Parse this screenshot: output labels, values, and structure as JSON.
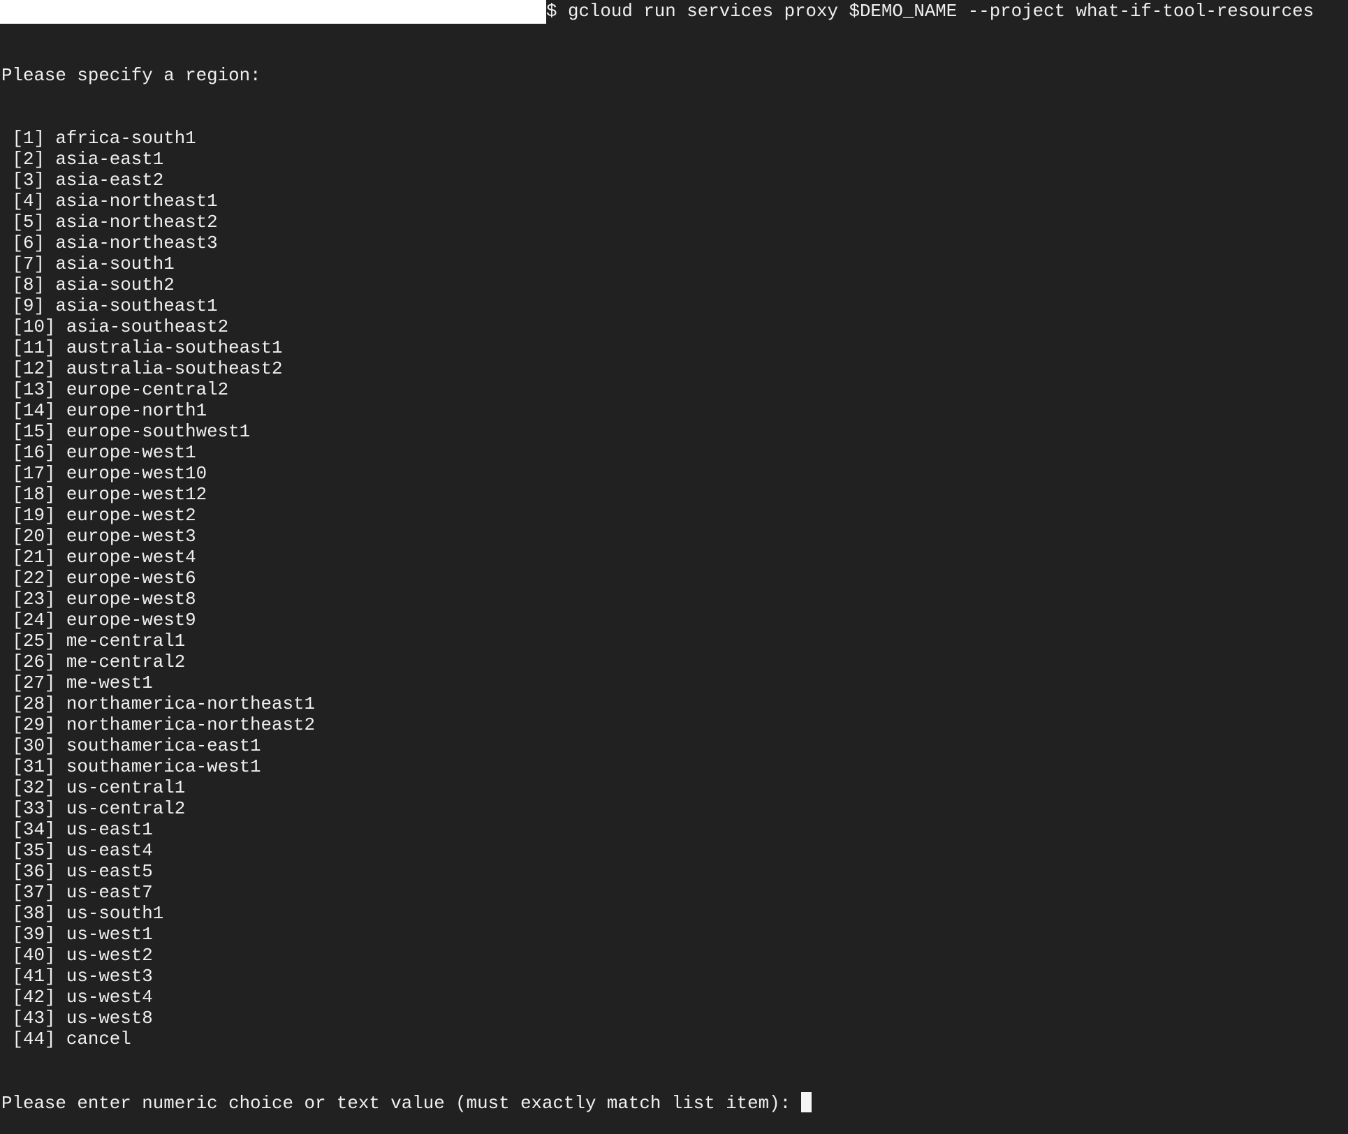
{
  "command": "$ gcloud run services proxy $DEMO_NAME --project what-if-tool-resources",
  "prompt_header": "Please specify a region:",
  "regions": [
    "[1] africa-south1",
    "[2] asia-east1",
    "[3] asia-east2",
    "[4] asia-northeast1",
    "[5] asia-northeast2",
    "[6] asia-northeast3",
    "[7] asia-south1",
    "[8] asia-south2",
    "[9] asia-southeast1",
    "[10] asia-southeast2",
    "[11] australia-southeast1",
    "[12] australia-southeast2",
    "[13] europe-central2",
    "[14] europe-north1",
    "[15] europe-southwest1",
    "[16] europe-west1",
    "[17] europe-west10",
    "[18] europe-west12",
    "[19] europe-west2",
    "[20] europe-west3",
    "[21] europe-west4",
    "[22] europe-west6",
    "[23] europe-west8",
    "[24] europe-west9",
    "[25] me-central1",
    "[26] me-central2",
    "[27] me-west1",
    "[28] northamerica-northeast1",
    "[29] northamerica-northeast2",
    "[30] southamerica-east1",
    "[31] southamerica-west1",
    "[32] us-central1",
    "[33] us-central2",
    "[34] us-east1",
    "[35] us-east4",
    "[36] us-east5",
    "[37] us-east7",
    "[38] us-south1",
    "[39] us-west1",
    "[40] us-west2",
    "[41] us-west3",
    "[42] us-west4",
    "[43] us-west8",
    "[44] cancel"
  ],
  "input_prompt": "Please enter numeric choice or text value (must exactly match list item):"
}
